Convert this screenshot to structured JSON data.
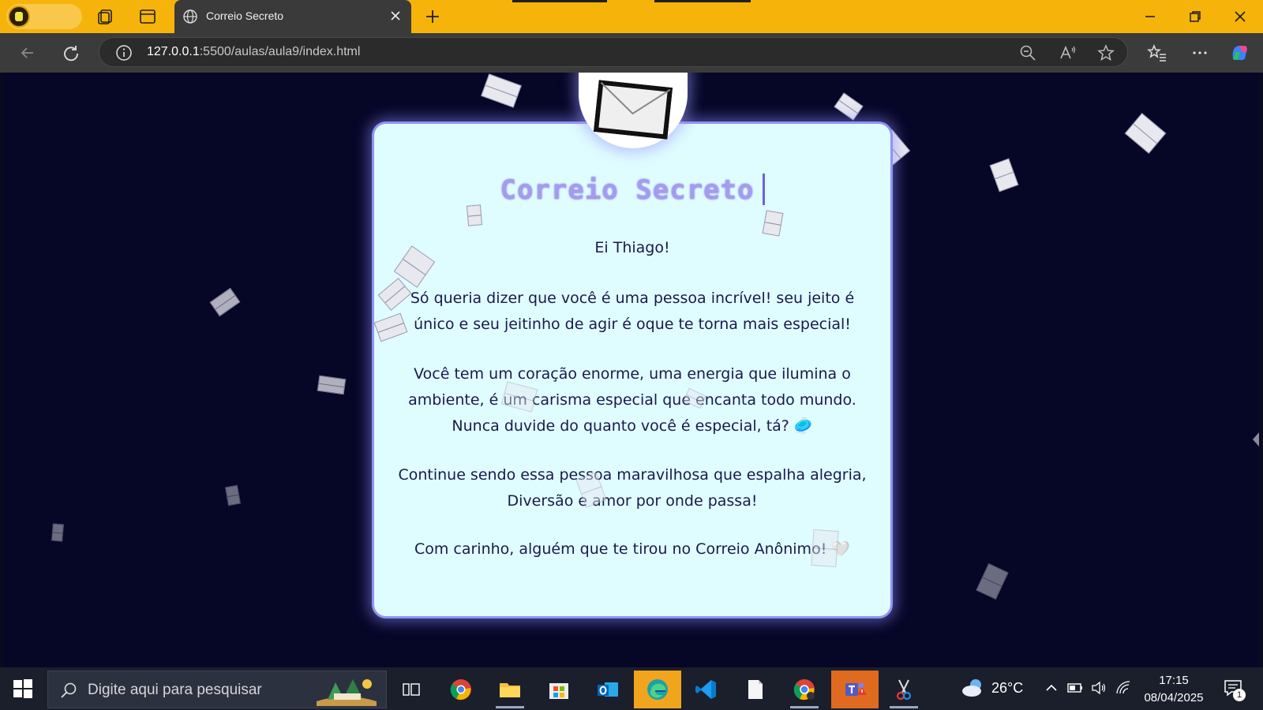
{
  "browser": {
    "tab_title": "Correio Secreto",
    "url_host": "127.0.0.1",
    "url_rest": ":5500/aulas/aula9/index.html",
    "theme_color": "#f6b30a"
  },
  "page": {
    "heading": "Correio Secreto",
    "greeting": "Ei Thiago!",
    "paragraph1_line1": "Só queria dizer que você é uma pessoa incrível! seu jeito é",
    "paragraph1_line2": "único e seu jeitinho de agir é oque te torna mais especial!",
    "paragraph2_line1": "Você tem um coração enorme, uma energia que ilumina o",
    "paragraph2_line2": "ambiente, é um carisma especial que encanta todo mundo.",
    "paragraph2_line3": "Nunca duvide do quanto você é especial, tá? 🥏",
    "paragraph3_line1": "Continue sendo essa pessoa maravilhosa que espalha alegria,",
    "paragraph3_line2": "Diversão e amor por onde passa!",
    "signature": "Com carinho, alguém que te tirou no Correio Anônimo! 🤍",
    "card_bg": "#dffcff",
    "card_border": "#8f95f5",
    "page_bg": "#060627"
  },
  "taskbar": {
    "search_placeholder": "Digite aqui para pesquisar",
    "temperature": "26°C",
    "time": "17:15",
    "date": "08/04/2025",
    "notification_count": "1"
  }
}
